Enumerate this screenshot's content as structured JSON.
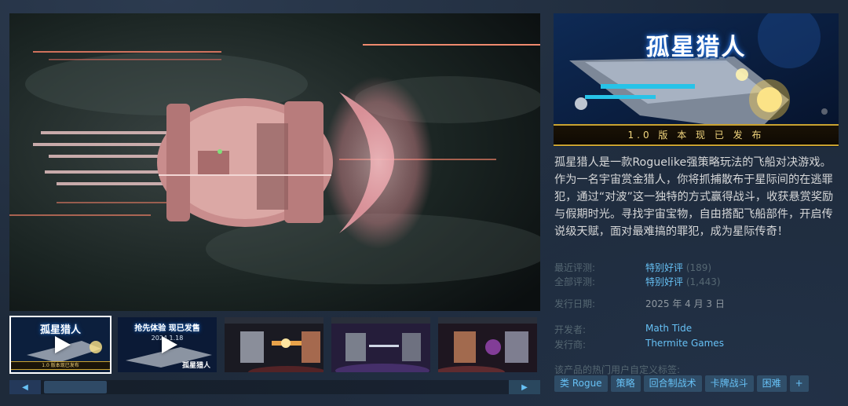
{
  "main_media": {
    "alt": "screenshot"
  },
  "thumbnails": [
    {
      "title": "孤星猎人",
      "sub": "",
      "ribbon": "1.0 版本现已发布",
      "logo": "",
      "has_play": true
    },
    {
      "title": "抢先体验 现已发售",
      "sub": "2024.1.18",
      "ribbon": "",
      "logo": "孤星猎人",
      "has_play": true
    },
    {
      "title": "",
      "sub": "",
      "ribbon": "",
      "logo": "",
      "has_play": false
    },
    {
      "title": "",
      "sub": "",
      "ribbon": "",
      "logo": "",
      "has_play": false
    },
    {
      "title": "",
      "sub": "",
      "ribbon": "",
      "logo": "",
      "has_play": false
    }
  ],
  "slider": {
    "left": "◀",
    "right": "▶"
  },
  "capsule": {
    "title": "孤星猎人",
    "ribbon": "1.0 版 本 现 已 发 布"
  },
  "description": "孤星猎人是一款Roguelike强策略玩法的飞船对决游戏。作为一名宇宙赏金猎人，你将抓捕散布于星际间的在逃罪犯，通过“对波”这一独特的方式赢得战斗，收获悬赏奖励与假期时光。寻找宇宙宝物，自由搭配飞船部件，开启传说级天赋，面对最难搞的罪犯，成为星际传奇！",
  "reviews": {
    "recent_label": "最近评测:",
    "recent_value": "特别好评",
    "recent_count": "(189)",
    "all_label": "全部评测:",
    "all_value": "特别好评",
    "all_count": "(1,443)"
  },
  "release": {
    "label": "发行日期:",
    "value": "2025 年 4 月 3 日"
  },
  "developer": {
    "label": "开发者:",
    "value": "Math Tide"
  },
  "publisher": {
    "label": "发行商:",
    "value": "Thermite Games"
  },
  "tags": {
    "title": "该产品的热门用户自定义标签:",
    "items": [
      "类 Rogue",
      "策略",
      "回合制战术",
      "卡牌战斗",
      "困难",
      "+"
    ]
  },
  "colors": {
    "link": "#66c0f4",
    "muted": "#556772",
    "text": "#d6d7d8",
    "bg": "#1b2838",
    "ribbon_gold": "#c9a230"
  },
  "icons": [
    "play-icon",
    "arrow-left-icon",
    "arrow-right-icon"
  ]
}
